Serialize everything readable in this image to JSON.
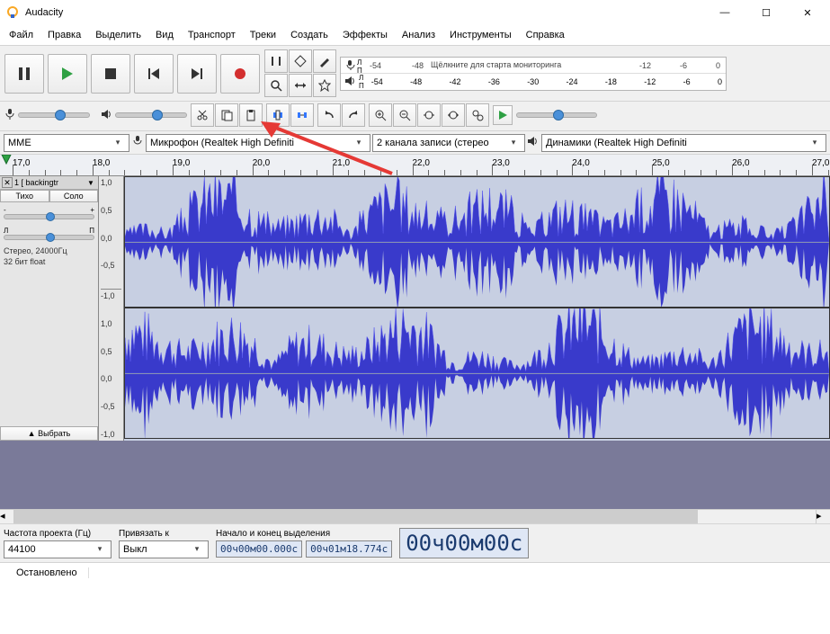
{
  "title": "Audacity",
  "win_buttons": {
    "min": "—",
    "max": "☐",
    "close": "✕"
  },
  "menu": [
    "Файл",
    "Правка",
    "Выделить",
    "Вид",
    "Транспорт",
    "Треки",
    "Создать",
    "Эффекты",
    "Анализ",
    "Инструменты",
    "Справка"
  ],
  "meter": {
    "rec_ticks": [
      "-54",
      "-48"
    ],
    "rec_hint": "Щёлкните для старта мониторинга",
    "rec_right": [
      "-12",
      "-6",
      "0"
    ],
    "play_ticks": [
      "-54",
      "-48",
      "-42",
      "-36",
      "-30",
      "-24",
      "-18",
      "-12",
      "-6",
      "0"
    ]
  },
  "device": {
    "host": "MME",
    "rec": "Микрофон (Realtek High Definiti",
    "chan": "2 канала записи (стерео",
    "play": "Динамики (Realtek High Definiti"
  },
  "timeline": {
    "start": 17.0,
    "ticks": [
      "17,0",
      "18,0",
      "19,0",
      "20,0",
      "21,0",
      "22,0",
      "23,0",
      "24,0",
      "25,0",
      "26,0",
      "27,0"
    ]
  },
  "track": {
    "name": "1 [ backingtr",
    "mute": "Тихо",
    "solo": "Соло",
    "gain_minus": "-",
    "gain_plus": "+",
    "pan_L": "Л",
    "pan_R": "П",
    "info1": "Стерео, 24000Гц",
    "info2": "32 бит  float",
    "select": "Выбрать"
  },
  "wavescale": [
    "1,0",
    "0,5",
    "0,0",
    "-0,5",
    "-1,0"
  ],
  "bottom": {
    "rate_label": "Частота проекта (Гц)",
    "rate_value": "44100",
    "snap_label": "Привязать к",
    "snap_value": "Выкл",
    "sel_label": "Начало и конец выделения",
    "sel_start": "00ч00м00.000с",
    "sel_end": "00ч01м18.774с",
    "audio_pos": "00ч00м00с"
  },
  "status": "Остановлено"
}
